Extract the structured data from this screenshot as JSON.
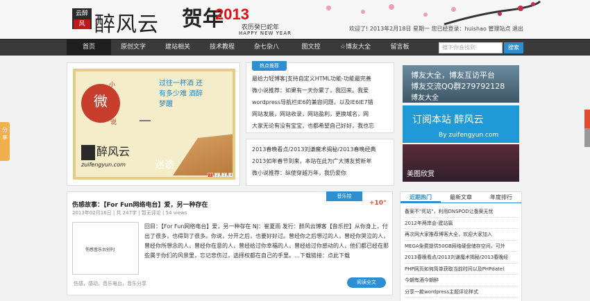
{
  "header": {
    "logo_top": "云醉",
    "logo_bottom": "风",
    "site_name": "醉风云",
    "banner": {
      "chun": "贺年",
      "year": "2013",
      "cn": "农历癸巳蛇年",
      "en": "HAPPY NEW YEAR"
    },
    "user_bar": "欢迎了! 2013年2月18日 星期一 您已经登录：huishao 管理站点 退出"
  },
  "nav": {
    "items": [
      "首页",
      "原创文字",
      "建站相关",
      "技术教程",
      "杂七杂八",
      "图文控",
      "☆博友大全",
      "留言板"
    ],
    "search_placeholder": "搜下你会找到",
    "search_button": "搜索"
  },
  "side_tab": "分享",
  "slider": {
    "wei": "微",
    "xiao": "小",
    "shuo": "说",
    "poem": "过往一杯酒 还有多少难 酒醉梦醒",
    "name": "醉风云",
    "url": "zuifengyun.com",
    "mi": "迷途",
    "dots": [
      "1",
      "2",
      "3",
      "4",
      "5"
    ]
  },
  "hot": {
    "tag": "热点推荐",
    "items": [
      "最给力轻博客|支持自定义HTML功能-功能最完善",
      "微小说推荐：如果有一天你累了，我回来。我爱",
      "wordpress导航栏IE6的兼容问题，以及IE6IE7错",
      "网站发展，网站收录，网站盈利，更换域名，网",
      "大家无论有没有宝宝，也都希望自己好好，我也忘"
    ]
  },
  "news": {
    "items": [
      "2013春晚看点/2013刘谦魔术揭秘/2013春晚经典",
      "2013如年春节到来，本站在此为广大博友贺新年",
      "微小说推荐：纵使穿越万年，我仍爱你"
    ]
  },
  "ads": {
    "ad1": {
      "t1": "博友大全，博友互访平台",
      "t2": "博友交流QQ群279792128",
      "t3": "博友大全"
    },
    "ad2": {
      "t1": "订阅本站 醉风云",
      "t2": "By zuifengyun.com"
    },
    "ad3": {
      "t1": "美图欣赏"
    }
  },
  "article": {
    "music_tag": "音乐控",
    "plus": "+10°",
    "title": "伤感故事：【For Fun网络电台】爱，另一种存在",
    "meta": "2013年02月16日 | 共 247字 | 暂无评论 | 54 views",
    "thumb_text": "伤感音乐台创刊",
    "excerpt": "回目：【For Fun网络电台】爱，另一种存在 NJ：崔夏雨 发行：醉风云博客【音乐控】从你身上，付出了很多，也得到了很多。你说，分开之后，也要好好过。曾经你之后想过的人，曾经你哭泣的人，曾经你所想念的人，曾经你在意的人，曾经给过你幸福的人，曾经给过你感动的人，他们都已经在那些属于你们的风景里，忘记悲伤过，选择权都在自己的手里。…下载链接：点此下载",
    "tags": "伤感，感动，音乐电台，音乐分享",
    "read_more": "阅读全文"
  },
  "rank": {
    "tabs": [
      "近期热门",
      "最新文章",
      "年度排行"
    ],
    "items": [
      "备案不\"死站\"，利用DNSPOD让备案无忧",
      "2012年两岸会-建站篇",
      "再次网大家推荐博客大全，欢迎大家加入",
      "MEGA免费提供50GB网络硬盘储存空间，可外",
      "2013春晚看点/2013刘谦魔术揭秘/2013春晚经",
      "PHP网页如何简单获取当前时间以及PHPdate(",
      "今朝有酒今朝醉",
      "分享一款wordpress主题评论样式"
    ]
  },
  "colors": {
    "accent": "#2d8fd0",
    "nav_bg": "#3a3a3a",
    "brand_red": "#d11111",
    "side_tab": "#f0b04c"
  }
}
